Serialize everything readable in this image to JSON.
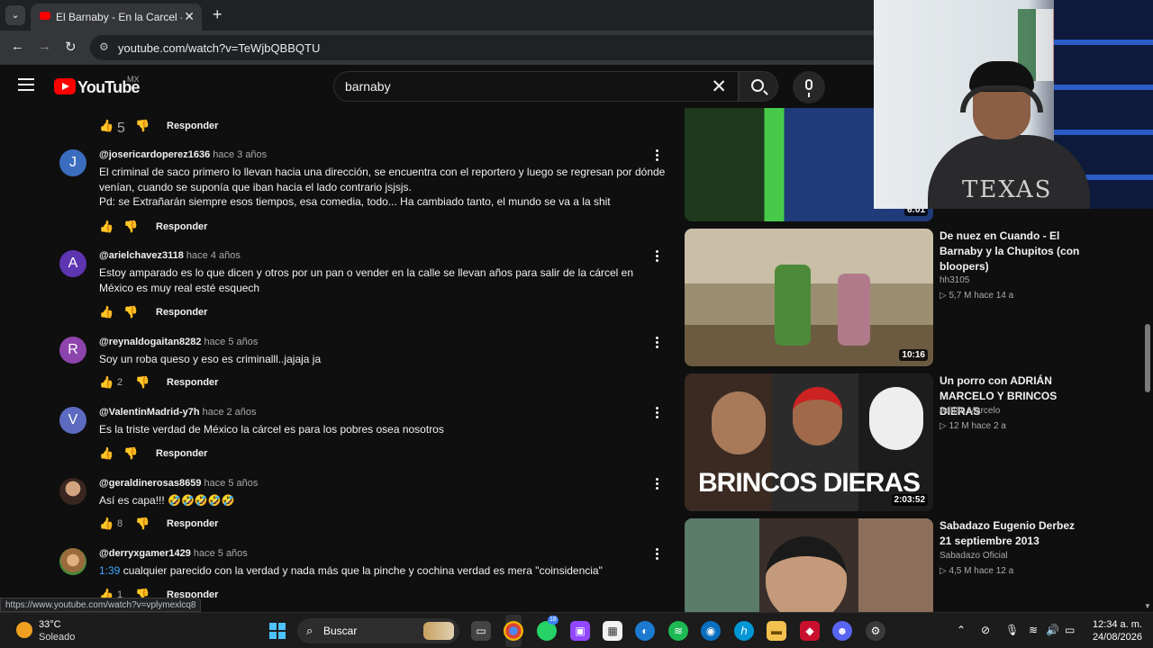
{
  "browser": {
    "tab_title": "El Barnaby - En la Carcel - YouT",
    "url": "youtube.com/watch?v=TeWjbQBBQTU",
    "status_url": "https://www.youtube.com/watch?v=vplymexlcq8"
  },
  "header": {
    "logo": "YouTube",
    "country": "MX",
    "search_query": "barnaby"
  },
  "top_actions": {
    "likes": "5",
    "reply": "Responder"
  },
  "comments": [
    {
      "avatar_letter": "J",
      "avatar_color": "#3b6dbf",
      "handle": "@josericardoperez1636",
      "time": "hace 3 años",
      "text": "El criminal de saco primero lo llevan hacia una dirección, se encuentra con el reportero y luego se regresan por dónde venían, cuando se suponía que iban hacia el lado contrario jsjsjs.\nPd: se Extrañarán siempre esos tiempos, esa comedia, todo... Ha cambiado tanto, el mundo se va a la shit",
      "likes": "",
      "reply": "Responder"
    },
    {
      "avatar_letter": "A",
      "avatar_color": "#5e35b1",
      "handle": "@arielchavez3118",
      "time": "hace 4 años",
      "text": "Estoy amparado es lo que dicen y otros por un pan o vender en la calle se llevan años para salir de la cárcel en México es muy real esté esquech",
      "likes": "",
      "reply": "Responder"
    },
    {
      "avatar_letter": "R",
      "avatar_color": "#8e44ad",
      "handle": "@reynaldogaitan8282",
      "time": "hace 5 años",
      "text": "Soy un roba queso y eso es criminalll..jajaja ja",
      "likes": "2",
      "reply": "Responder"
    },
    {
      "avatar_letter": "V",
      "avatar_color": "#5c6bc0",
      "handle": "@ValentinMadrid-y7h",
      "time": "hace 2 años",
      "text": "Es la triste verdad de México la cárcel es para los pobres osea nosotros",
      "likes": "",
      "reply": "Responder"
    },
    {
      "avatar_letter": "",
      "avatar_color": "#6d4c41",
      "handle": "@geraldinerosas8659",
      "time": "hace 5 años",
      "text": "Así es capa!!! 🤣🤣🤣🤣🤣",
      "likes": "8",
      "reply": "Responder"
    },
    {
      "avatar_letter": "",
      "avatar_color": "#9c6b3c",
      "handle": "@derryxgamer1429",
      "time": "hace 5 años",
      "timestamp_link": "1:39",
      "text": "cualquier parecido con la verdad y nada más que la pinche y cochina verdad es mera \"coinsidencia\"",
      "likes": "1",
      "reply": "Responder"
    }
  ],
  "sidebar": {
    "videos": [
      {
        "title": "",
        "channel": "",
        "stats": "",
        "duration": "6:01",
        "thumb_colors": [
          "#1d3a1d",
          "#47c94a",
          "#203a7a"
        ]
      },
      {
        "title": "De nuez en Cuando - El Barnaby y la Chupitos (con bloopers)",
        "channel": "hh3105",
        "stats": "▷ 5,7 M  hace 14 a",
        "duration": "10:16",
        "thumb_colors": [
          "#b9b09a",
          "#7a6b4e",
          "#3f8a3a"
        ]
      },
      {
        "title": "Un porro con ADRIÁN MARCELO Y BRINCOS DIERAS",
        "channel": "Adrián Marcelo",
        "stats": "▷ 12 M  hace 2 a",
        "duration": "2:03:52",
        "thumb_text": "BRINCOS DIERAS",
        "thumb_colors": [
          "#2a2a2a",
          "#6b3a2a",
          "#ddd"
        ]
      },
      {
        "title": "Sabadazo Eugenio Derbez 21 septiembre 2013",
        "channel": "Sabadazo Oficial",
        "stats": "▷ 4,5 M  hace 12 a",
        "duration": "",
        "thumb_colors": [
          "#5a7b6a",
          "#3a2f2a",
          "#8c6f5a"
        ]
      }
    ]
  },
  "webcam": {
    "shirt_text": "TEXAS"
  },
  "taskbar": {
    "temperature": "33°C",
    "weather": "Soleado",
    "search_label": "Buscar",
    "time": "12:34 a. m.",
    "date": "24/08/2026",
    "whatsapp_badge": "18"
  }
}
